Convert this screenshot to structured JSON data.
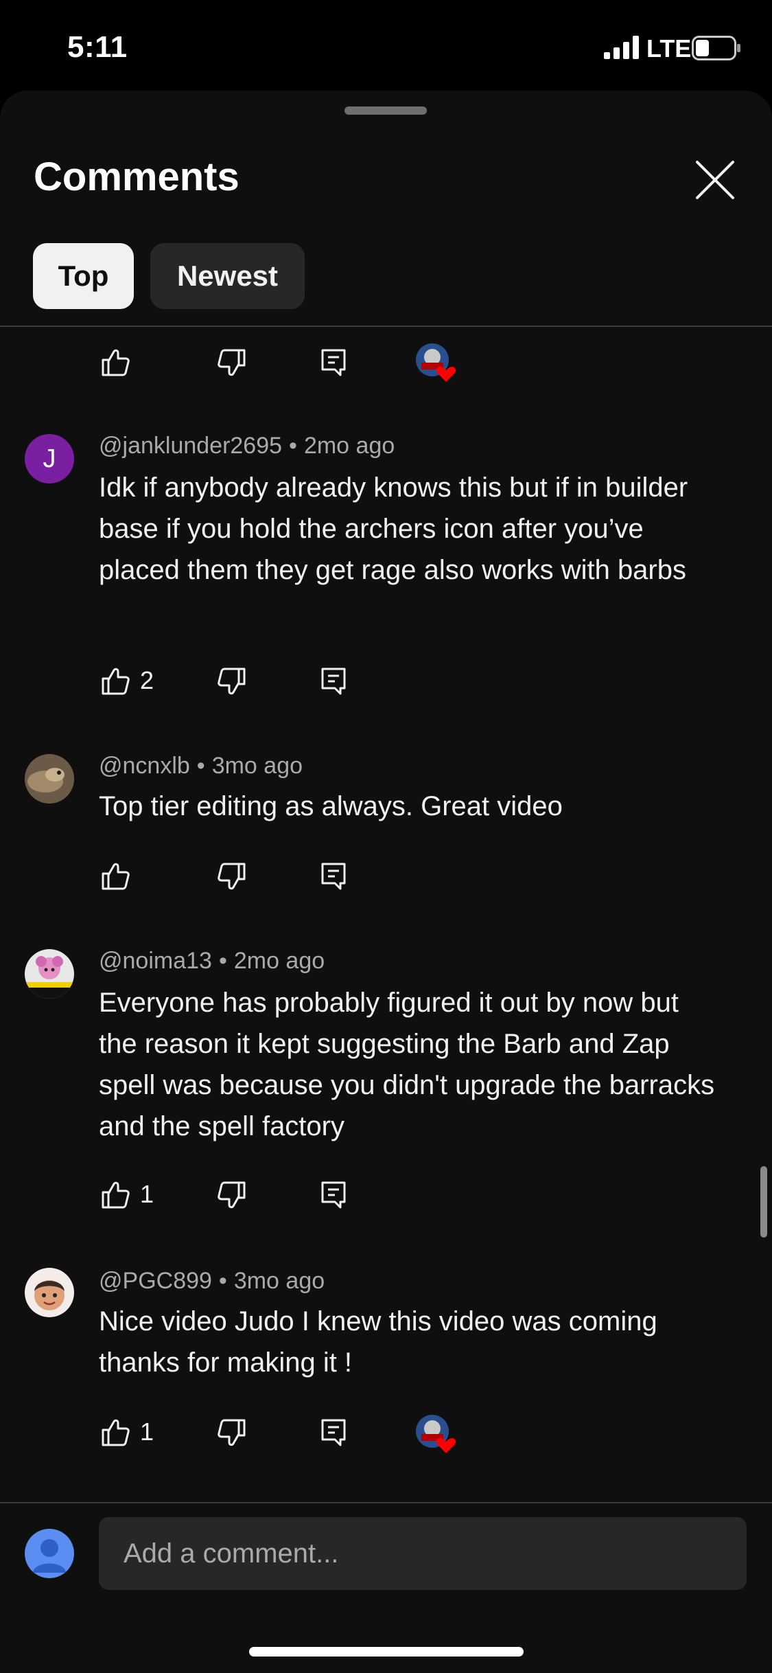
{
  "status_bar": {
    "time": "5:11",
    "network": "LTE"
  },
  "header": {
    "title": "Comments"
  },
  "filters": {
    "top_label": "Top",
    "newest_label": "Newest"
  },
  "comments": [
    {
      "author": "@janklunder2695",
      "time": "2mo ago",
      "avatar_letter": "J",
      "text": "Idk if anybody already knows this but if in builder base if you hold the archers icon after you’ve placed them they get rage also works with barbs",
      "likes": "2"
    },
    {
      "author": "@ncnxlb",
      "time": "3mo ago",
      "text": "Top tier editing as always. Great video",
      "likes": ""
    },
    {
      "author": "@noima13",
      "time": "2mo ago",
      "text": "Everyone has probably figured it out by now but the reason it kept suggesting the Barb and Zap spell was because you didn't upgrade the barracks and the spell factory",
      "likes": "1"
    },
    {
      "author": "@PGC899",
      "time": "3mo ago",
      "text": "Nice video Judo I knew this video was coming thanks for making it !",
      "likes": "1"
    }
  ],
  "composer": {
    "placeholder": "Add a comment..."
  },
  "colors": {
    "background": "#0f0f0f",
    "heart": "#ff0000",
    "avatar_j": "#7b1fa2",
    "composer_avatar": "#5b8ef0"
  }
}
